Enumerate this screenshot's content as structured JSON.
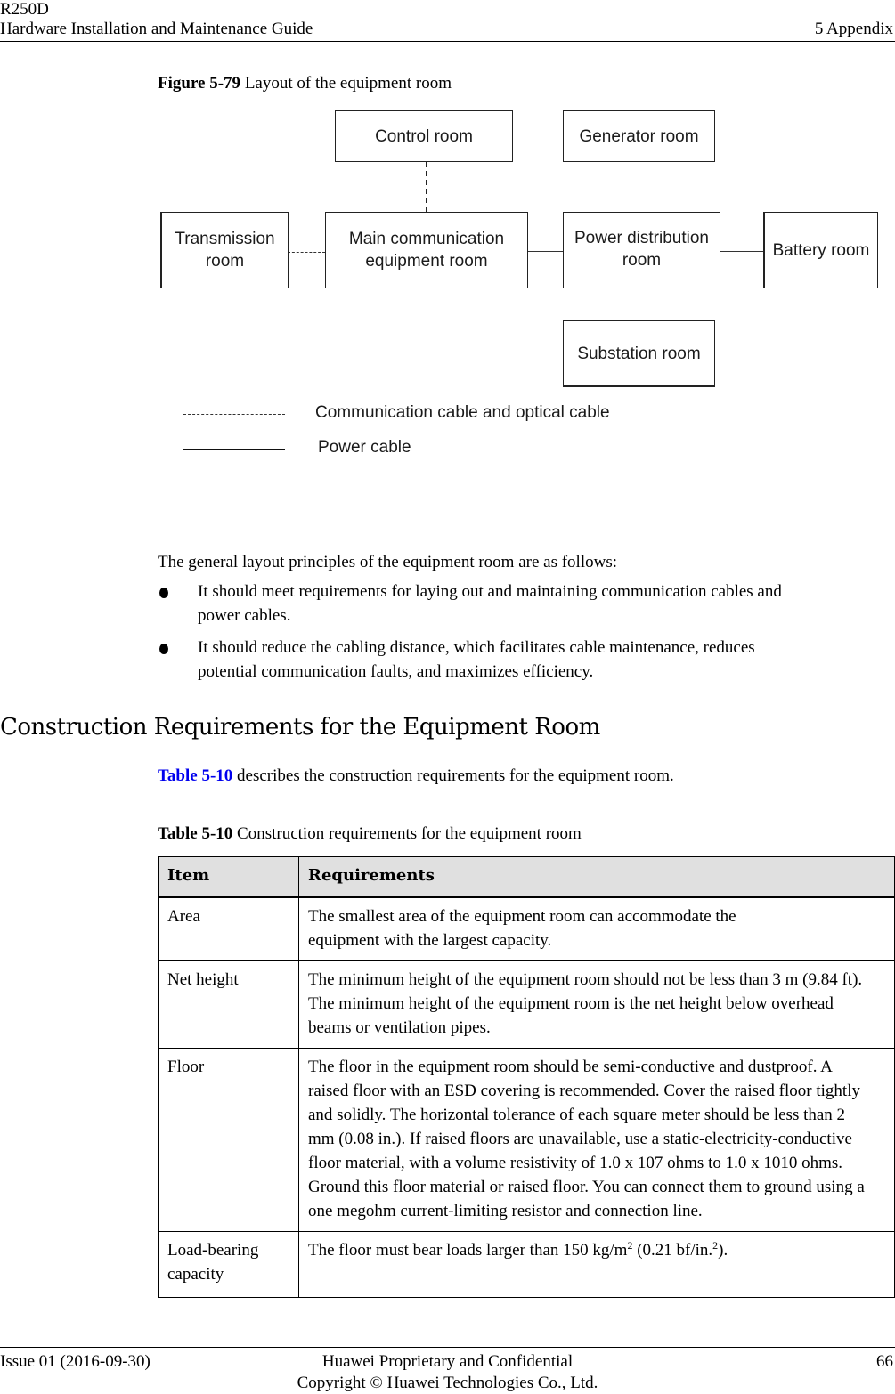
{
  "header": {
    "product": "R250D",
    "guide_title": "Hardware Installation and Maintenance Guide",
    "chapter": "5 Appendix"
  },
  "figure": {
    "label": "Figure 5-79",
    "title": "Layout of the equipment room",
    "rooms": {
      "control": "Control room",
      "generator": "Generator room",
      "transmission_line1": "Transmission",
      "transmission_line2": "room",
      "main_comm_line1": "Main communication",
      "main_comm_line2": "equipment room",
      "power_dist_line1": "Power distribution",
      "power_dist_line2": "room",
      "battery": "Battery room",
      "substation": "Substation room"
    },
    "connections": [
      {
        "from": "Control room",
        "to": "Main communication equipment room",
        "type": "communication"
      },
      {
        "from": "Transmission room",
        "to": "Main communication equipment room",
        "type": "communication"
      },
      {
        "from": "Main communication equipment room",
        "to": "Power distribution room",
        "type": "power"
      },
      {
        "from": "Generator room",
        "to": "Power distribution room",
        "type": "power"
      },
      {
        "from": "Power distribution room",
        "to": "Battery room",
        "type": "power"
      },
      {
        "from": "Power distribution room",
        "to": "Substation room",
        "type": "power"
      }
    ],
    "legend": {
      "communication": "Communication cable and optical cable",
      "power": "Power cable"
    }
  },
  "intro": "The general layout principles of the equipment room are as follows:",
  "bullets": [
    {
      "line1": "It should meet requirements for laying out and maintaining communication cables and",
      "line2": "power cables."
    },
    {
      "line1": "It should reduce the cabling distance, which facilitates cable maintenance, reduces",
      "line2": "potential communication faults, and maximizes efficiency."
    }
  ],
  "section": {
    "heading": "Construction Requirements for the Equipment Room",
    "ref_link": "Table 5-10",
    "ref_text": " describes the construction requirements for the equipment room."
  },
  "table": {
    "label": "Table 5-10",
    "title": "Construction requirements for the equipment room",
    "columns": [
      "Item",
      "Requirements"
    ],
    "rows": [
      {
        "item": "Area",
        "requirement": "The smallest area of the equipment room can accommodate the equipment with the largest capacity."
      },
      {
        "item": "Net height",
        "requirement": "The minimum height of the equipment room should not be less than 3 m (9.84 ft). The minimum height of the equipment room is the net height below overhead beams or ventilation pipes."
      },
      {
        "item": "Floor",
        "requirement": "The floor in the equipment room should be semi-conductive and dustproof. A raised floor with an ESD covering is recommended. Cover the raised floor tightly and solidly. The horizontal tolerance of each square meter should be less than 2 mm (0.08 in.). If raised floors are unavailable, use a static-electricity-conductive floor material, with a volume resistivity of 1.0 x 107 ohms to 1.0 x 1010 ohms. Ground this floor material or raised floor. You can connect them to ground using a one megohm current-limiting resistor and connection line."
      },
      {
        "item": "Load-bearing capacity",
        "requirement_part1": "The floor must bear loads larger than 150 kg/m",
        "sup1": "2",
        "requirement_part2": " (0.21 bf/in.",
        "sup2": "2",
        "requirement_part3": ")."
      }
    ]
  },
  "footer": {
    "issue": "Issue 01 (2016-09-30)",
    "confidential": "Huawei Proprietary and Confidential",
    "copyright": "Copyright © Huawei Technologies Co., Ltd.",
    "page": "66"
  }
}
